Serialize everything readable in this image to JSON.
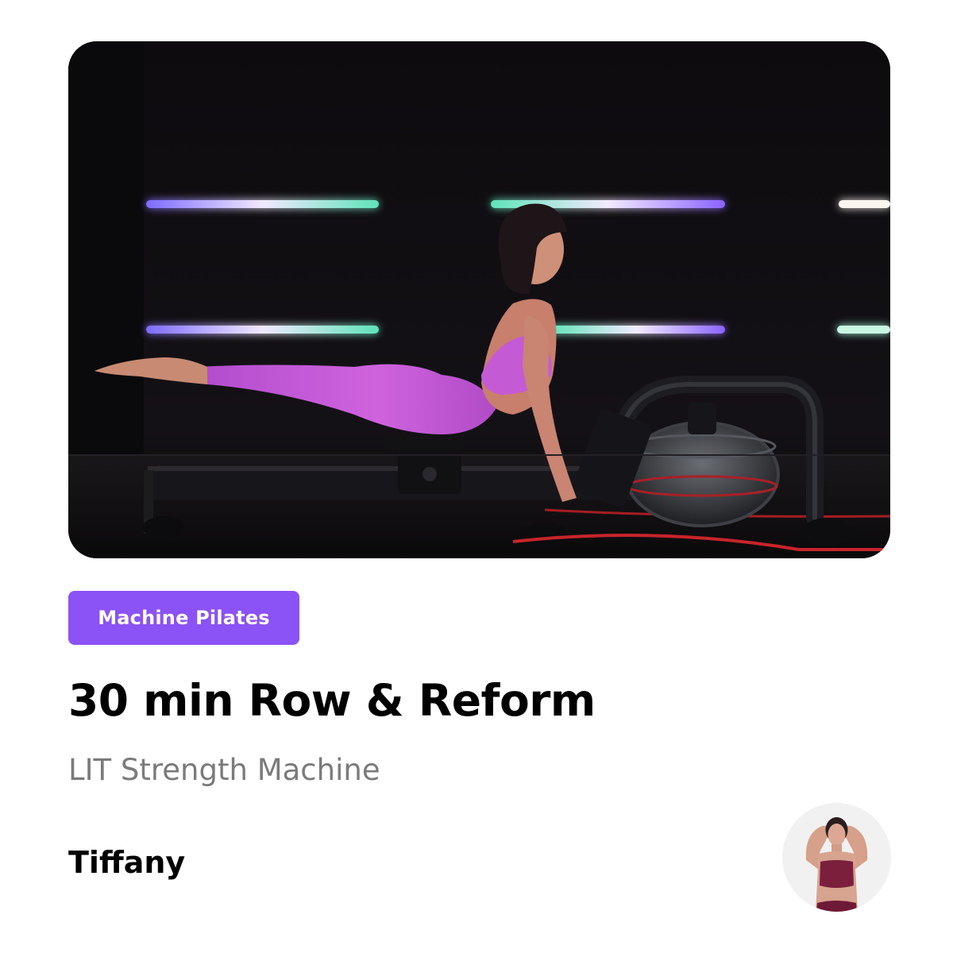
{
  "workout": {
    "category": "Machine Pilates",
    "title": "30 min Row & Reform",
    "equipment": "LIT Strength Machine",
    "instructor": "Tiffany"
  },
  "colors": {
    "badge_background": "#8b52f5",
    "title_text": "#000000",
    "subtitle_text": "#7b7b7b",
    "leggings": "#c05ad6",
    "led_purple": "#8a63ff",
    "led_teal": "#5fe0b4"
  },
  "icons": {
    "hero": "workout-video-thumbnail",
    "avatar": "instructor-avatar"
  }
}
